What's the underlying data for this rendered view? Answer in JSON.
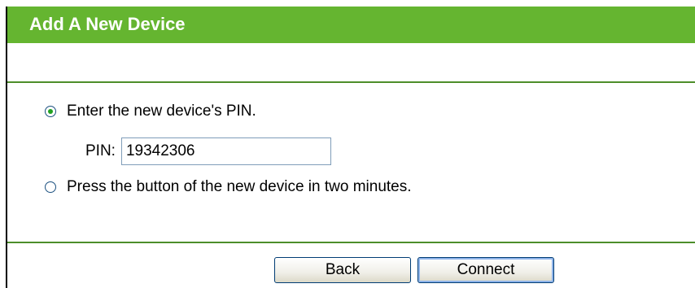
{
  "page": {
    "title": "Add A New Device"
  },
  "options": {
    "pin_option": {
      "label": "Enter the new device's PIN.",
      "selected": true
    },
    "pbc_option": {
      "label": "Press the button of the new device in two minutes.",
      "selected": false
    }
  },
  "pin": {
    "label": "PIN:",
    "value": "19342306"
  },
  "buttons": {
    "back_label": "Back",
    "connect_label": "Connect"
  },
  "colors": {
    "title_bar": "#65b530",
    "title_text": "#ffffff",
    "divider": "#4d8e2a",
    "radio_dot": "#21a121"
  }
}
